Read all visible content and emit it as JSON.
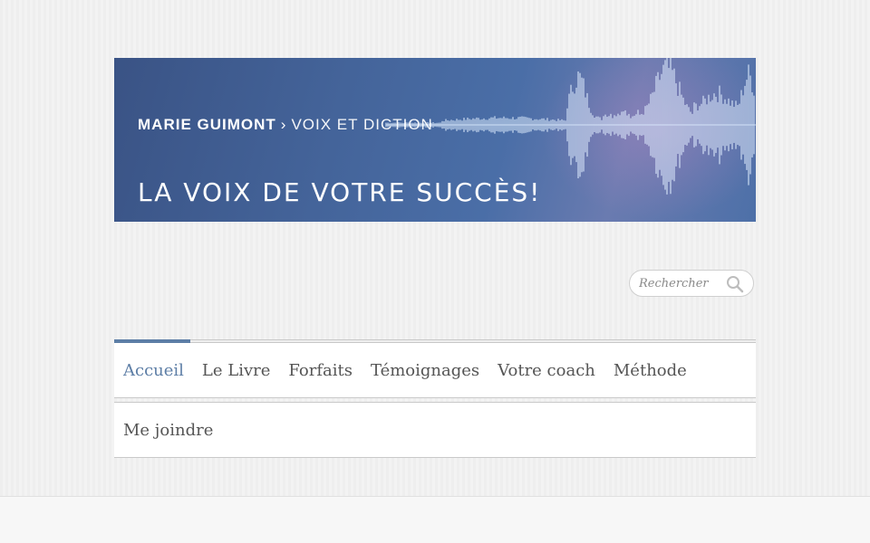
{
  "banner": {
    "brand_name": "MARIE GUIMONT",
    "separator": "›",
    "service": "VOIX ET DICTION",
    "slogan": "LA VOIX DE VOTRE SUCCÈS!"
  },
  "search": {
    "placeholder": "Rechercher",
    "icon": "search-icon"
  },
  "nav": {
    "row1": [
      {
        "label": "Accueil",
        "active": true
      },
      {
        "label": "Le Livre"
      },
      {
        "label": "Forfaits"
      },
      {
        "label": "Témoignages"
      },
      {
        "label": "Votre coach"
      },
      {
        "label": "Méthode"
      }
    ],
    "row2": [
      {
        "label": "Me joindre"
      }
    ]
  },
  "colors": {
    "accent": "#5d7ea6",
    "text": "#555555",
    "banner": "#44649a"
  }
}
